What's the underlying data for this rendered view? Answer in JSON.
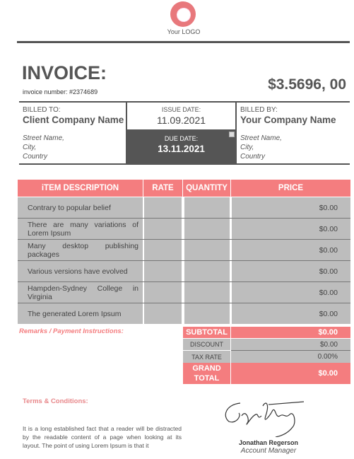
{
  "logo": {
    "text": "Your LOGO",
    "color": "#e8787c"
  },
  "invoice": {
    "title": "INVOICE:",
    "number_label": "invoice number: #2374689",
    "amount": "$3.5696, 00"
  },
  "billed_to": {
    "label": "BILLED TO:",
    "name": "Client Company Name",
    "street": "Street Name,",
    "city": "City,",
    "country": "Country"
  },
  "issue_date": {
    "label": "ISSUE DATE:",
    "value": "11.09.2021"
  },
  "due_date": {
    "label": "DUE DATE:",
    "value": "13.11.2021"
  },
  "billed_by": {
    "label": "BILLED BY:",
    "name": "Your Company Name",
    "street": "Street Name,",
    "city": "City,",
    "country": "Country"
  },
  "table": {
    "headers": [
      "iTEM DESCRIPTION",
      "RATE",
      "QUANTITY",
      "PRICE"
    ],
    "rows": [
      {
        "description": "Contrary to popular belief",
        "rate": "",
        "quantity": "",
        "price": "$0.00"
      },
      {
        "description": "There are many variations of Lorem Ipsum",
        "rate": "",
        "quantity": "",
        "price": "$0.00"
      },
      {
        "description": "Many desktop publishing packages",
        "rate": "",
        "quantity": "",
        "price": "$0.00"
      },
      {
        "description": "Various versions have evolved",
        "rate": "",
        "quantity": "",
        "price": "$0.00"
      },
      {
        "description": "Hampden-Sydney College in Virginia",
        "rate": "",
        "quantity": "",
        "price": "$0.00"
      },
      {
        "description": "The generated Lorem Ipsum",
        "rate": "",
        "quantity": "",
        "price": "$0.00"
      }
    ]
  },
  "remarks_label": "Remarks / Payment Instructions:",
  "totals": {
    "subtotal": {
      "label": "SUBTOTAL",
      "value": "$0.00"
    },
    "discount": {
      "label": "DISCOUNT",
      "value": "$0.00"
    },
    "tax_rate": {
      "label": "TAX RATE",
      "value": "0.00%"
    },
    "grand_total": {
      "label": "GRAND TOTAL",
      "value": "$0.00"
    }
  },
  "terms": {
    "label": "Terms & Conditions:",
    "text": "It is a long established fact that a reader will be distracted by the readable content of a page when looking at its layout. The point of using Lorem Ipsum is that it"
  },
  "signer": {
    "name": "Jonathan Regerson",
    "title": "Account Manager"
  },
  "colors": {
    "accent": "#f47d7f",
    "dark": "#555555",
    "cell": "#bdbdbd"
  }
}
